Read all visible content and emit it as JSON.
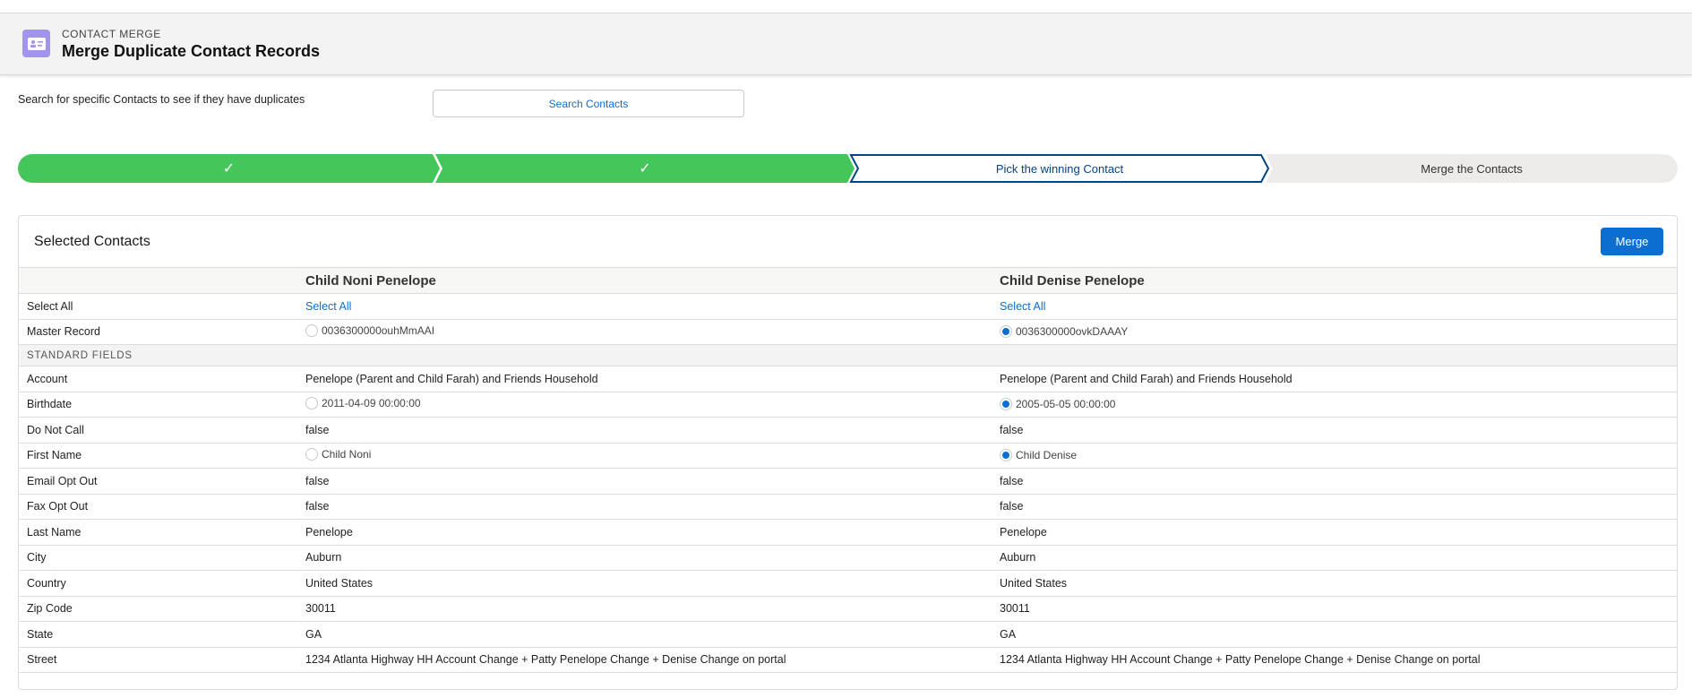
{
  "header": {
    "eyebrow": "CONTACT MERGE",
    "title": "Merge Duplicate Contact Records",
    "icon": "contact-card-icon"
  },
  "search": {
    "description": "Search for specific Contacts to see if they have duplicates",
    "button_label": "Search Contacts"
  },
  "path": {
    "steps": [
      {
        "label": "",
        "status": "complete"
      },
      {
        "label": "",
        "status": "complete"
      },
      {
        "label": "Pick the winning Contact",
        "status": "current"
      },
      {
        "label": "Merge the Contacts",
        "status": "incomplete"
      }
    ],
    "colors": {
      "complete": "#45c65a",
      "current_border": "#014486",
      "incomplete": "#ecebea"
    }
  },
  "card": {
    "title": "Selected Contacts",
    "merge_label": "Merge",
    "contacts": [
      "Child Noni Penelope",
      "Child Denise Penelope"
    ],
    "select_all_label": "Select All",
    "select_all_link": "Select All",
    "master_label": "Master Record",
    "master_ids": [
      "0036300000ouhMmAAI",
      "0036300000ovkDAAAY"
    ],
    "master_selected": 1,
    "section_label": "STANDARD FIELDS",
    "fields": [
      {
        "label": "Account",
        "values": [
          "Penelope (Parent and Child Farah) and Friends Household",
          "Penelope (Parent and Child Farah) and Friends Household"
        ],
        "radio": false
      },
      {
        "label": "Birthdate",
        "values": [
          "2011-04-09 00:00:00",
          "2005-05-05 00:00:00"
        ],
        "radio": true,
        "selected": 1
      },
      {
        "label": "Do Not Call",
        "values": [
          "false",
          "false"
        ],
        "radio": false
      },
      {
        "label": "First Name",
        "values": [
          "Child Noni",
          "Child Denise"
        ],
        "radio": true,
        "selected": 1
      },
      {
        "label": "Email Opt Out",
        "values": [
          "false",
          "false"
        ],
        "radio": false
      },
      {
        "label": "Fax Opt Out",
        "values": [
          "false",
          "false"
        ],
        "radio": false
      },
      {
        "label": "Last Name",
        "values": [
          "Penelope",
          "Penelope"
        ],
        "radio": false
      },
      {
        "label": "City",
        "values": [
          "Auburn",
          "Auburn"
        ],
        "radio": false
      },
      {
        "label": "Country",
        "values": [
          "United States",
          "United States"
        ],
        "radio": false
      },
      {
        "label": "Zip Code",
        "values": [
          "30011",
          "30011"
        ],
        "radio": false
      },
      {
        "label": "State",
        "values": [
          "GA",
          "GA"
        ],
        "radio": false
      },
      {
        "label": "Street",
        "values": [
          "1234 Atlanta Highway HH Account Change + Patty Penelope Change + Denise Change on portal",
          "1234 Atlanta Highway HH Account Change + Patty Penelope Change + Denise Change on portal"
        ],
        "radio": false
      }
    ]
  }
}
